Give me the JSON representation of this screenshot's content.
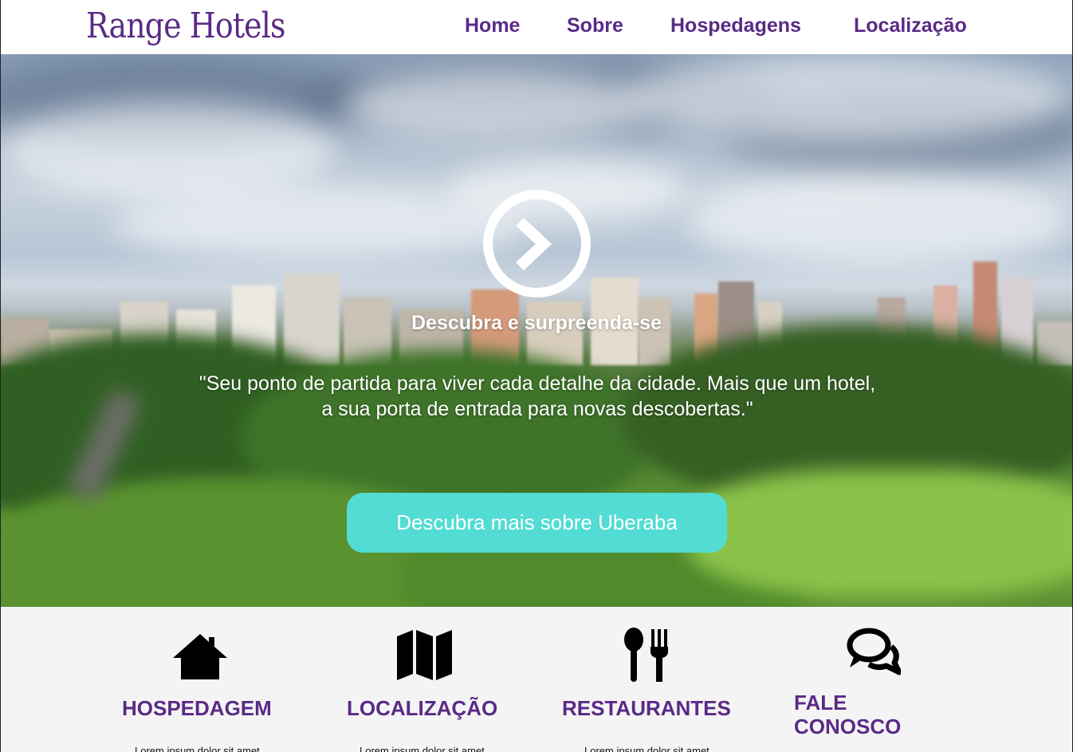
{
  "brand": {
    "name": "Range Hotels",
    "color": "#5a2a86"
  },
  "nav": {
    "items": [
      {
        "label": "Home"
      },
      {
        "label": "Sobre"
      },
      {
        "label": "Hospedagens"
      },
      {
        "label": "Localização"
      }
    ]
  },
  "hero": {
    "icon": "chevron-right-circle-icon",
    "title": "Descubra e surpreenda-se",
    "quote": "\"Seu ponto de partida para viver cada detalhe da cidade. Mais que um hotel, a sua porta de entrada para novas descobertas.\"",
    "button_label": "Descubra mais sobre Uberaba",
    "button_color": "#52dcd3"
  },
  "features": [
    {
      "icon": "house-icon",
      "title": "HOSPEDAGEM",
      "text": "Lorem ipsum dolor sit amet"
    },
    {
      "icon": "map-icon",
      "title": "LOCALIZAÇÃO",
      "text": "Lorem ipsum dolor sit amet"
    },
    {
      "icon": "fork-spoon-icon",
      "title": "RESTAURANTES",
      "text": "Lorem ipsum dolor sit amet"
    },
    {
      "icon": "chat-bubbles-icon",
      "title": "FALE CONOSCO",
      "text": ""
    }
  ]
}
